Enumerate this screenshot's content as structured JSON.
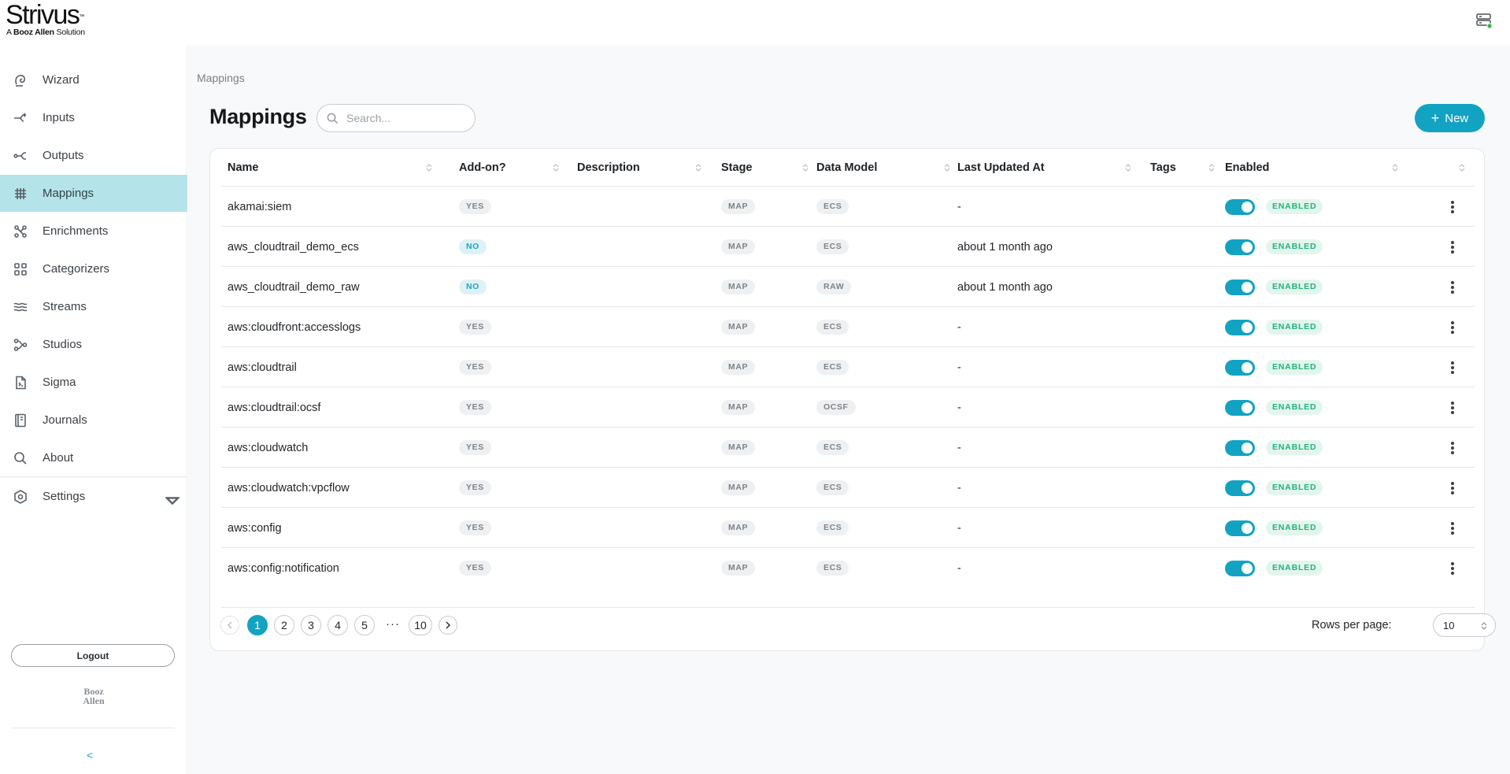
{
  "brand": {
    "name": "Strivus",
    "tm": "™",
    "sub_prefix": "A",
    "sub_bold": "Booz Allen",
    "sub_suffix": " Solution",
    "partner_line1": "Booz",
    "partner_line2": "Allen"
  },
  "sidebar": {
    "items": [
      {
        "label": "Wizard",
        "icon": "wizard-icon"
      },
      {
        "label": "Inputs",
        "icon": "inputs-icon"
      },
      {
        "label": "Outputs",
        "icon": "outputs-icon"
      },
      {
        "label": "Mappings",
        "icon": "mappings-icon",
        "active": true
      },
      {
        "label": "Enrichments",
        "icon": "enrichments-icon"
      },
      {
        "label": "Categorizers",
        "icon": "categorizers-icon"
      },
      {
        "label": "Streams",
        "icon": "streams-icon"
      },
      {
        "label": "Studios",
        "icon": "studios-icon"
      },
      {
        "label": "Sigma",
        "icon": "sigma-icon"
      },
      {
        "label": "Journals",
        "icon": "journals-icon"
      },
      {
        "label": "About",
        "icon": "about-icon"
      }
    ],
    "settings_label": "Settings",
    "logout_label": "Logout",
    "collapse_label": "<"
  },
  "breadcrumb": "Mappings",
  "page_title": "Mappings",
  "search": {
    "placeholder": "Search..."
  },
  "new_button": {
    "plus": "+",
    "label": "New"
  },
  "table": {
    "columns": [
      "Name",
      "Add-on?",
      "Description",
      "Stage",
      "Data Model",
      "Last Updated At",
      "Tags",
      "Enabled"
    ],
    "rows": [
      {
        "name": "akamai:siem",
        "addon": "YES",
        "description": "",
        "stage": "MAP",
        "model": "ECS",
        "updated": "-",
        "tags": "",
        "enabled": "ENABLED"
      },
      {
        "name": "aws_cloudtrail_demo_ecs",
        "addon": "NO",
        "description": "",
        "stage": "MAP",
        "model": "ECS",
        "updated": "about 1 month ago",
        "tags": "",
        "enabled": "ENABLED"
      },
      {
        "name": "aws_cloudtrail_demo_raw",
        "addon": "NO",
        "description": "",
        "stage": "MAP",
        "model": "RAW",
        "updated": "about 1 month ago",
        "tags": "",
        "enabled": "ENABLED"
      },
      {
        "name": "aws:cloudfront:accesslogs",
        "addon": "YES",
        "description": "",
        "stage": "MAP",
        "model": "ECS",
        "updated": "-",
        "tags": "",
        "enabled": "ENABLED"
      },
      {
        "name": "aws:cloudtrail",
        "addon": "YES",
        "description": "",
        "stage": "MAP",
        "model": "ECS",
        "updated": "-",
        "tags": "",
        "enabled": "ENABLED"
      },
      {
        "name": "aws:cloudtrail:ocsf",
        "addon": "YES",
        "description": "",
        "stage": "MAP",
        "model": "OCSF",
        "updated": "-",
        "tags": "",
        "enabled": "ENABLED"
      },
      {
        "name": "aws:cloudwatch",
        "addon": "YES",
        "description": "",
        "stage": "MAP",
        "model": "ECS",
        "updated": "-",
        "tags": "",
        "enabled": "ENABLED"
      },
      {
        "name": "aws:cloudwatch:vpcflow",
        "addon": "YES",
        "description": "",
        "stage": "MAP",
        "model": "ECS",
        "updated": "-",
        "tags": "",
        "enabled": "ENABLED"
      },
      {
        "name": "aws:config",
        "addon": "YES",
        "description": "",
        "stage": "MAP",
        "model": "ECS",
        "updated": "-",
        "tags": "",
        "enabled": "ENABLED"
      },
      {
        "name": "aws:config:notification",
        "addon": "YES",
        "description": "",
        "stage": "MAP",
        "model": "ECS",
        "updated": "-",
        "tags": "",
        "enabled": "ENABLED"
      }
    ]
  },
  "pagination": {
    "pages": [
      "1",
      "2",
      "3",
      "4",
      "5"
    ],
    "ellipsis": "···",
    "last_page": "10",
    "current": "1",
    "rows_per_page_label": "Rows per page:",
    "rows_per_page_value": "10"
  },
  "colors": {
    "accent": "#12a3c2",
    "active_nav": "#b5e3ea",
    "enabled_green": "#22b27a",
    "status_dot": "#3cb44b"
  }
}
